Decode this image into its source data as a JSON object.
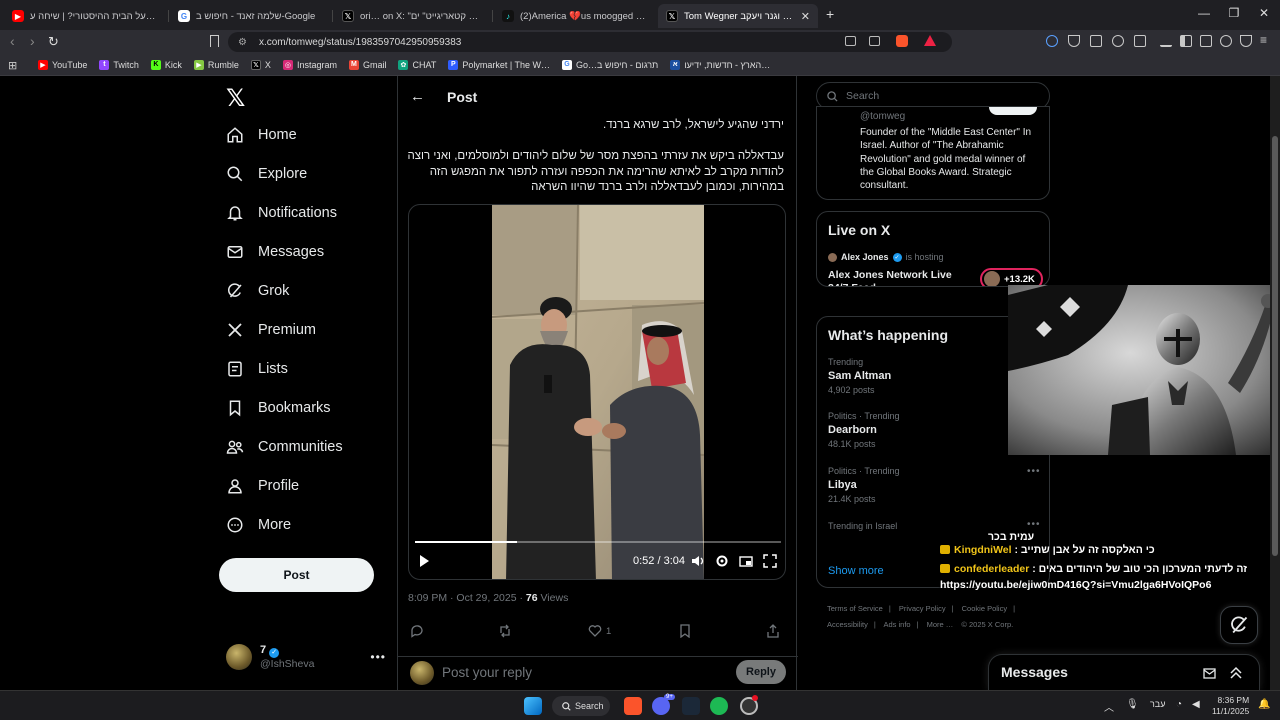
{
  "browser": {
    "tabs": [
      {
        "title": "מי פה בעל הבית ההיסטורי? | שיחה ע…",
        "icon": "youtube-icon",
        "active": false
      },
      {
        "title": "שלמה זאנד - חיפוש ב-Google",
        "icon": "google-icon",
        "active": false
      },
      {
        "title": "ori… on X: \"פרשת קטאריגייט\" ים…",
        "icon": "x-icon",
        "active": false
      },
      {
        "title": "(2)America 💔us moogged edit Som…",
        "icon": "tiktok-icon",
        "active": false
      },
      {
        "title": "Tom Wegner תום וגנר ויעקב…",
        "icon": "x-icon",
        "active": true
      }
    ],
    "new_tab": "+",
    "url": "x.com/tomweg/status/1983597042950959383",
    "bookmarks": [
      {
        "label": "YouTube",
        "color": "#ff0000"
      },
      {
        "label": "Twitch",
        "color": "#9146ff"
      },
      {
        "label": "Kick",
        "color": "#53fc18"
      },
      {
        "label": "Rumble",
        "color": "#85c742"
      },
      {
        "label": "X",
        "color": "#000000"
      },
      {
        "label": "Instagram",
        "color": "#d62976"
      },
      {
        "label": "Gmail",
        "color": "#ea4335"
      },
      {
        "label": "CHAT",
        "color": "#10a37f"
      },
      {
        "label": "Polymarket | The W…",
        "color": "#2e5cff"
      },
      {
        "label": "Go…תרגום - חיפוש ב",
        "color": "#4285f4"
      },
      {
        "label": "הארץ - חדשות, ידיעו…",
        "color": "#1b4fa0"
      }
    ]
  },
  "nav": {
    "items": [
      {
        "label": "Home",
        "icon": "home-icon"
      },
      {
        "label": "Explore",
        "icon": "search-icon"
      },
      {
        "label": "Notifications",
        "icon": "bell-icon"
      },
      {
        "label": "Messages",
        "icon": "envelope-icon"
      },
      {
        "label": "Grok",
        "icon": "grok-icon"
      },
      {
        "label": "Premium",
        "icon": "x-icon"
      },
      {
        "label": "Lists",
        "icon": "list-icon"
      },
      {
        "label": "Bookmarks",
        "icon": "bookmark-icon"
      },
      {
        "label": "Communities",
        "icon": "people-icon"
      },
      {
        "label": "Profile",
        "icon": "person-icon"
      },
      {
        "label": "More",
        "icon": "more-circle-icon"
      }
    ],
    "post_button": "Post",
    "account": {
      "name": "7",
      "handle": "@IshSheva"
    }
  },
  "post": {
    "header": "Post",
    "text_line1": "ירדני שהגיע לישראל, לרב שרגא ברנד.",
    "text_para2": "עבדאללה ביקש את עזרתי בהפצת מסר של שלום ליהודים ולמוסלמים, ואני רוצה להודות מקרב לב לאיתא שהרימה את הכפפה ועזרה לתפור את המפגש הזה במהירות, וכמובן לעבדאללה ולרב ברנד שהיוו השראה",
    "video": {
      "time": "0:52 / 3:04",
      "progress": 0.28
    },
    "timestamp": "8:09 PM · Oct 29, 2025 · ",
    "views_count": "76",
    "views_label": " Views",
    "likes": "1",
    "reply_placeholder": "Post your reply",
    "reply_button": "Reply"
  },
  "sidebar": {
    "search_placeholder": "Search",
    "profile": {
      "handle": "@tomweg",
      "bio": "Founder of the \"Middle East Center\" In Israel. Author of \"The Abrahamic Revolution\" and gold medal winner of the Global Books Award. Strategic consultant."
    },
    "live": {
      "title": "Live on X",
      "host": "Alex Jones",
      "host_suffix": "is hosting",
      "stream_title": "Alex Jones Network Live 24/7 Feed",
      "listeners": "+13.2K"
    },
    "happening": {
      "title": "What’s happening",
      "trends": [
        {
          "context": "Trending",
          "name": "Sam Altman",
          "posts": "4,902 posts"
        },
        {
          "context": "Politics · Trending",
          "name": "Dearborn",
          "posts": "48.1K posts"
        },
        {
          "context": "Politics · Trending",
          "name": "Libya",
          "posts": "21.4K posts"
        },
        {
          "context": "Trending in Israel",
          "name": "עמית בכר",
          "posts": ""
        }
      ],
      "show_more": "Show more"
    },
    "footer": {
      "links": [
        "Terms of Service",
        "Privacy Policy",
        "Cookie Policy",
        "Accessibility",
        "Ads info",
        "More …"
      ],
      "copyright": "© 2025 X Corp."
    }
  },
  "overlay_chat": [
    {
      "user": "KingdniWel",
      "message": "כי האלקסה זה על אבן שתייב"
    },
    {
      "user": "confederleader",
      "message": "זה לדעתי המערכון הכי טוב של היהודים באים"
    },
    {
      "user": "",
      "message": "https://youtu.be/ejiw0mD416Q?si=Vmu2lga6HVoIQPo6"
    }
  ],
  "messages_drawer": {
    "title": "Messages"
  },
  "taskbar": {
    "search": "Search",
    "lang": "עבר",
    "time": "8:36 PM",
    "date": "11/1/2025",
    "discord_badge": "9+"
  },
  "colors": {
    "accent": "#1d9bf0",
    "bg": "#000000",
    "border": "#2f3336",
    "muted": "#71767b",
    "live": "#e0245e"
  }
}
